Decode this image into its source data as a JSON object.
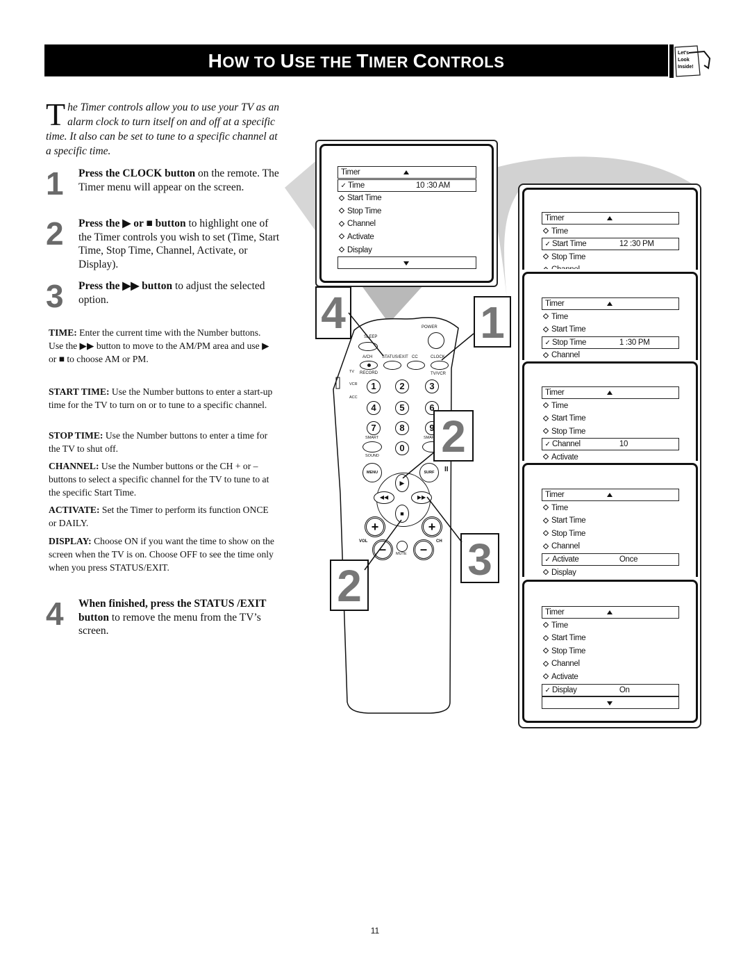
{
  "header": {
    "title_parts": [
      "H",
      "OW TO ",
      "U",
      "SE THE ",
      "T",
      "IMER ",
      "C",
      "ONTROLS"
    ],
    "title": "How to Use the Timer Controls",
    "badge_lines": [
      "Let's",
      "Look",
      "Inside!"
    ]
  },
  "intro": {
    "dropcap": "T",
    "text": "he Timer controls allow you to use your TV as an alarm clock to turn itself on and off at a specific time. It also can be set to tune to a specific channel at a specific time."
  },
  "steps": [
    {
      "number": "1",
      "bold": "Press the CLOCK button",
      "rest": " on the remote. The Timer menu will appear on the screen."
    },
    {
      "number": "2",
      "bold": "Press the ▶ or ■ button",
      "rest": " to highlight one of the Timer controls you wish to set (Time, Start Time, Stop Time, Channel, Activate, or Display)."
    },
    {
      "number": "3",
      "bold": "Press the ▶▶ button",
      "rest": " to adjust the selected option."
    },
    {
      "number": "4",
      "bold": "When finished, press the STATUS /EXIT button",
      "rest": " to remove the menu from the TV’s screen."
    }
  ],
  "definitions": [
    {
      "term": "TIME:",
      "text": " Enter the current time with the Number buttons. Use the ▶▶ button to move to the AM/PM area and use ▶ or ■ to choose AM or PM."
    },
    {
      "term": "START TIME:",
      "text": " Use the Number buttons to enter a start-up time for the TV to turn on or to tune to a specific channel."
    },
    {
      "term": "STOP TIME:",
      "text": " Use the Number buttons to enter a time for the TV to shut off."
    },
    {
      "term": "CHANNEL:",
      "text": " Use the Number buttons or the CH + or – buttons to select a specific channel for the TV to tune to at the specific Start Time."
    },
    {
      "term": "ACTIVATE:",
      "text": " Set the Timer to perform its function ONCE or DAILY."
    },
    {
      "term": "DISPLAY:",
      "text": " Choose ON if you want the time to show on the screen when the TV is on. Choose OFF to see the time only when you press STATUS/EXIT."
    }
  ],
  "menu": {
    "title": "Timer",
    "items": [
      "Time",
      "Start Time",
      "Stop Time",
      "Channel",
      "Activate",
      "Display"
    ],
    "screens": [
      {
        "selected": "Time",
        "value": "10 :30 AM"
      },
      {
        "selected": "Start Time",
        "value": "12 :30 PM"
      },
      {
        "selected": "Stop Time",
        "value": "1 :30 PM"
      },
      {
        "selected": "Channel",
        "value": "10"
      },
      {
        "selected": "Activate",
        "value": "Once"
      },
      {
        "selected": "Display",
        "value": "On"
      }
    ]
  },
  "remote": {
    "labels": {
      "power": "POWER",
      "sleep": "SLEEP",
      "ach": "A/CH",
      "status": "STATUS/EXIT",
      "cc": "CC",
      "clock": "CLOCK",
      "record": "RECORD",
      "tvvcr": "TV/VCR",
      "tv": "TV",
      "vcr": "VCR",
      "acc": "ACC",
      "smart_left": "SMART",
      "smart_right": "SMART",
      "sound": "SOUND",
      "menu": "MENU",
      "surf": "SURF",
      "vol": "VOL",
      "ch": "CH",
      "mute": "MUTE",
      "pause": "II"
    },
    "digits": [
      "1",
      "2",
      "3",
      "4",
      "5",
      "6",
      "7",
      "8",
      "9",
      "0"
    ]
  },
  "callouts": [
    "4",
    "1",
    "2",
    "2",
    "3"
  ],
  "page_number": "11"
}
